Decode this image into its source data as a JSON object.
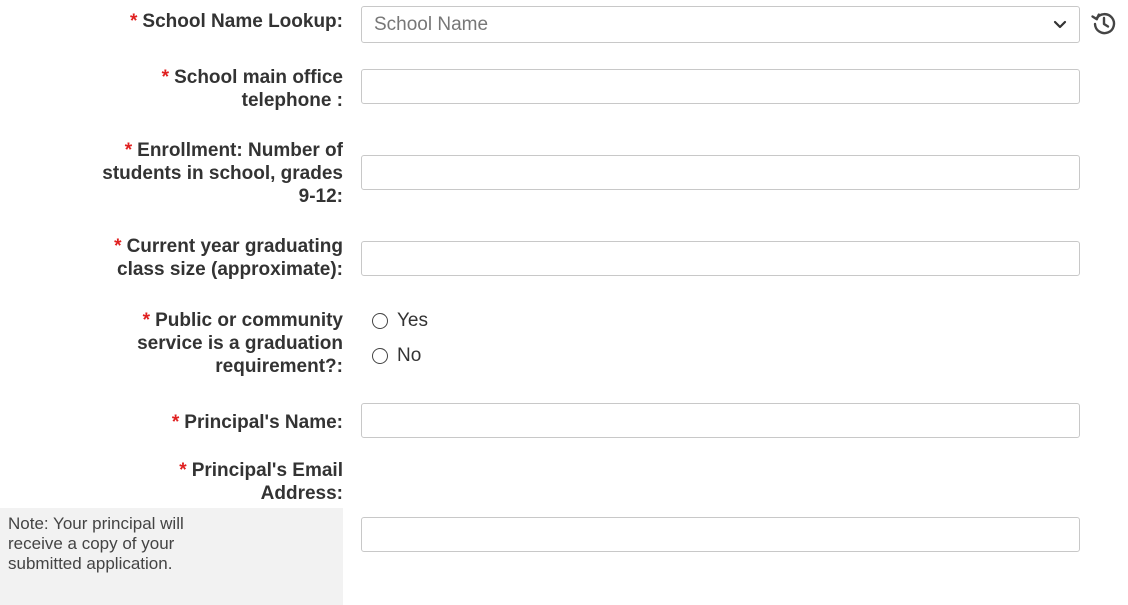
{
  "form": {
    "required_marker": "*",
    "school_lookup": {
      "label": "School Name Lookup:",
      "placeholder": "School Name"
    },
    "phone": {
      "label_line1": "School main office",
      "label_line2": "telephone :",
      "value": ""
    },
    "enrollment": {
      "label_line1": "Enrollment: Number of",
      "label_line2": "students in school, grades",
      "label_line3": "9-12:",
      "value": ""
    },
    "class_size": {
      "label_line1": "Current year graduating",
      "label_line2": "class size (approximate):",
      "value": ""
    },
    "service": {
      "label_line1": "Public or community",
      "label_line2": "service is a graduation",
      "label_line3": "requirement?:",
      "options": [
        "Yes",
        "No"
      ],
      "selected": null
    },
    "principal_name": {
      "label": "Principal's Name:",
      "value": ""
    },
    "principal_email": {
      "label_line1": "Principal's Email",
      "label_line2": "Address:",
      "note_line1": "Note: Your principal will",
      "note_line2": "receive a copy of your",
      "note_line3": "submitted application.",
      "value": ""
    }
  },
  "icons": {
    "dropdown": "chevron-down-icon",
    "history": "history-icon"
  },
  "colors": {
    "required": "#e02020",
    "border": "#c8c8c8",
    "note_background": "#f2f2f2"
  }
}
